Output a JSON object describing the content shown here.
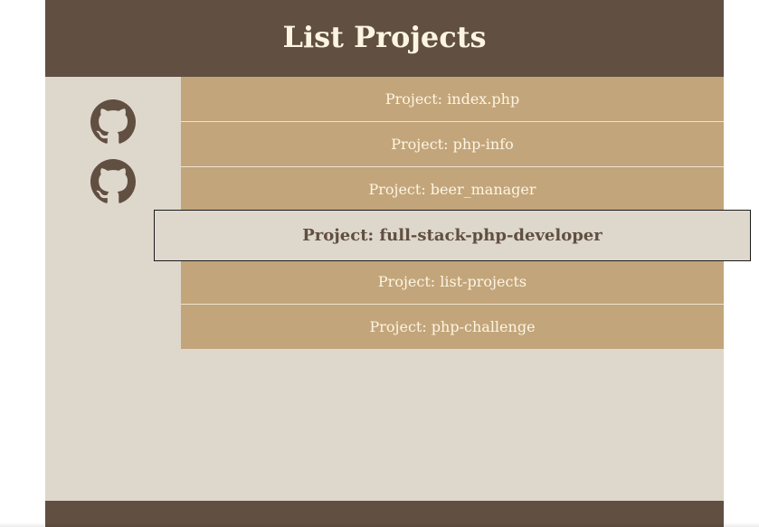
{
  "header": {
    "title": "List Projects"
  },
  "sidebar": {
    "links": [
      {
        "icon": "github-icon"
      },
      {
        "icon": "github-icon"
      }
    ]
  },
  "projects": [
    {
      "label": "Project: index.php",
      "active": false
    },
    {
      "label": "Project: php-info",
      "active": false
    },
    {
      "label": "Project: beer_manager",
      "active": false
    },
    {
      "label": "Project: full-stack-php-developer",
      "active": true
    },
    {
      "label": "Project: list-projects",
      "active": false
    },
    {
      "label": "Project: php-challenge",
      "active": false
    }
  ],
  "colors": {
    "header_bg": "#614f41",
    "header_text": "#fdf5e2",
    "page_bg": "#ded8cc",
    "item_bg": "#c3a57b",
    "item_text": "#fdf5e2",
    "active_text": "#614f41"
  }
}
